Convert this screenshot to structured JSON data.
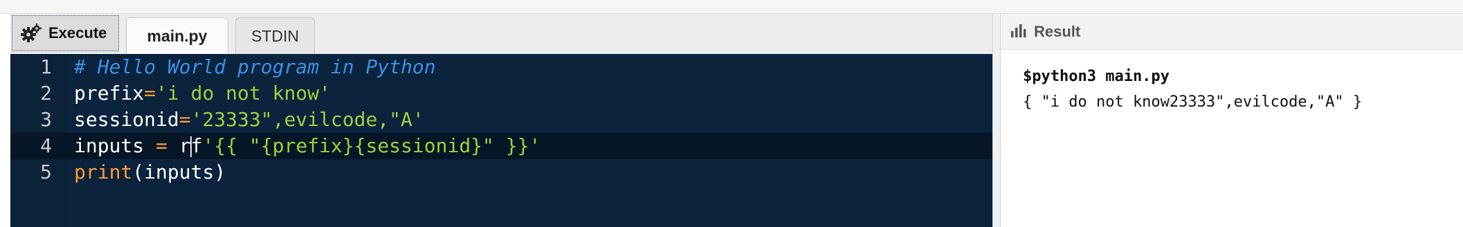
{
  "toolbar": {
    "execute_label": "Execute",
    "tabs": [
      {
        "label": "main.py",
        "active": true
      },
      {
        "label": "STDIN",
        "active": false
      }
    ]
  },
  "editor": {
    "language": "Python",
    "active_line": 4,
    "lines": [
      {
        "number": "1",
        "text": "# Hello World program in Python"
      },
      {
        "number": "2",
        "text": "prefix='i do not know'"
      },
      {
        "number": "3",
        "text": "sessionid='23333\",evilcode,\"A'"
      },
      {
        "number": "4",
        "text": "inputs = rf'{{ \"{prefix}{sessionid}\" }}'"
      },
      {
        "number": "5",
        "text": "print(inputs)"
      }
    ]
  },
  "result": {
    "title": "Result",
    "command": "$python3 main.py",
    "output": "{ \"i do not know23333\",evilcode,\"A\" }"
  },
  "colors": {
    "editor_bg": "#0b233d",
    "comment": "#3c8fe6",
    "string": "#9bd23c",
    "operator": "#ff9d2a",
    "identifier": "#ffffff"
  },
  "icons": {
    "execute": "gears-icon",
    "result": "bar-chart-icon"
  }
}
